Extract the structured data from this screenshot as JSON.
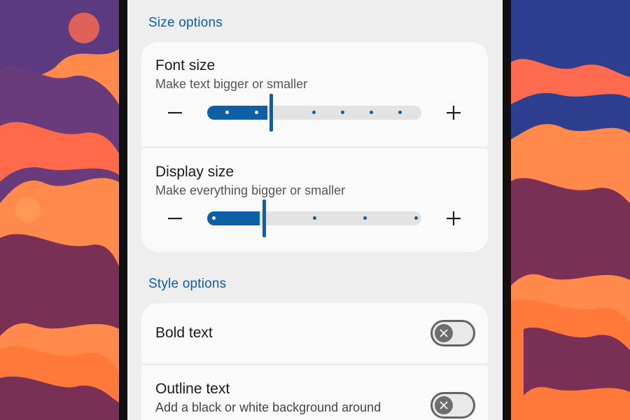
{
  "size_options": {
    "header": "Size options",
    "font_size": {
      "title": "Font size",
      "subtitle": "Make text bigger or smaller",
      "level": 3,
      "levels": 8
    },
    "display_size": {
      "title": "Display size",
      "subtitle": "Make everything bigger or smaller",
      "level": 2,
      "levels": 5
    }
  },
  "style_options": {
    "header": "Style options",
    "bold_text": {
      "title": "Bold text",
      "enabled": false
    },
    "outline_text": {
      "title": "Outline text",
      "subtitle": "Add a black or white background around",
      "enabled": false
    }
  },
  "colors": {
    "accent": "#0d5fa6",
    "section_header": "#0b5cad",
    "screen_bg": "#eeeeee",
    "card_bg": "#fafafa",
    "toggle_off": "#646464"
  },
  "icons": {
    "decrease": "minus-icon",
    "increase": "plus-icon",
    "toggle_off": "close-icon"
  }
}
